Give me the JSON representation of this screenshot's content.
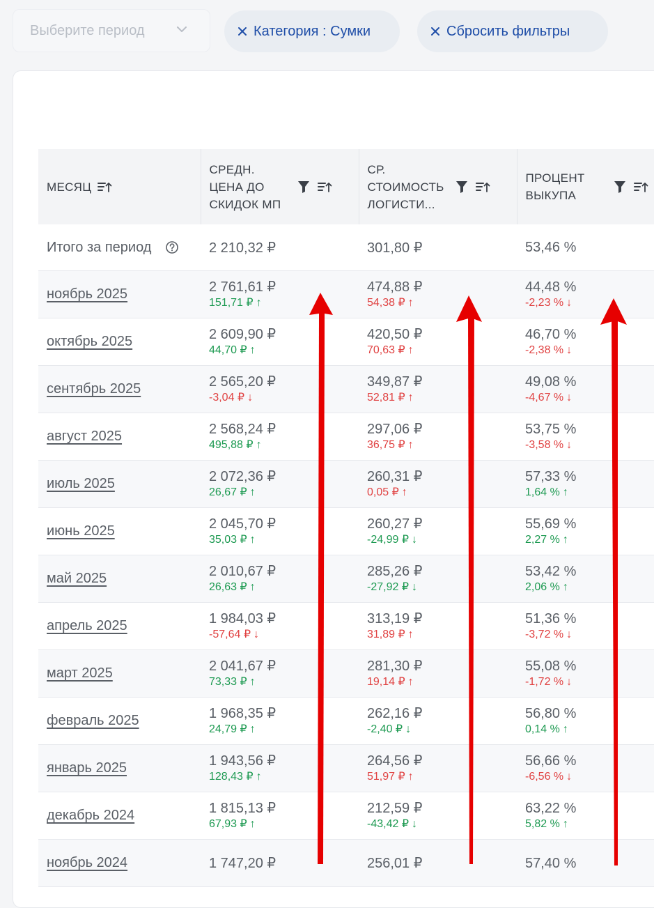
{
  "filters": {
    "period_placeholder": "Выберите период",
    "category_chip": "Категория : Сумки",
    "reset_chip": "Сбросить фильтры"
  },
  "table": {
    "headers": [
      {
        "label": "МЕСЯЦ"
      },
      {
        "label": "СРЕДН. ЦЕНА ДО СКИДОК МП"
      },
      {
        "label": "СР. СТОИМОСТЬ ЛОГИСТИ..."
      },
      {
        "label": "ПРОЦЕНТ ВЫКУПА"
      }
    ],
    "total": {
      "label": "Итого за период",
      "avg_price": "2 210,32 ₽",
      "logistics": "301,80 ₽",
      "buyout": "53,46 %"
    },
    "rows": [
      {
        "month": "ноябрь 2025",
        "avg_price": "2 761,61 ₽",
        "avg_price_delta": "151,71 ₽",
        "avg_price_dir": "up-green",
        "logistics": "474,88 ₽",
        "logistics_delta": "54,38 ₽",
        "logistics_dir": "up-red",
        "buyout": "44,48 %",
        "buyout_delta": "-2,23 %",
        "buyout_dir": "down-red"
      },
      {
        "month": "октябрь 2025",
        "avg_price": "2 609,90 ₽",
        "avg_price_delta": "44,70 ₽",
        "avg_price_dir": "up-green",
        "logistics": "420,50 ₽",
        "logistics_delta": "70,63 ₽",
        "logistics_dir": "up-red",
        "buyout": "46,70 %",
        "buyout_delta": "-2,38 %",
        "buyout_dir": "down-red"
      },
      {
        "month": "сентябрь 2025",
        "avg_price": "2 565,20 ₽",
        "avg_price_delta": "-3,04 ₽",
        "avg_price_dir": "down-red",
        "logistics": "349,87 ₽",
        "logistics_delta": "52,81 ₽",
        "logistics_dir": "up-red",
        "buyout": "49,08 %",
        "buyout_delta": "-4,67 %",
        "buyout_dir": "down-red"
      },
      {
        "month": "август 2025",
        "avg_price": "2 568,24 ₽",
        "avg_price_delta": "495,88 ₽",
        "avg_price_dir": "up-green",
        "logistics": "297,06 ₽",
        "logistics_delta": "36,75 ₽",
        "logistics_dir": "up-red",
        "buyout": "53,75 %",
        "buyout_delta": "-3,58 %",
        "buyout_dir": "down-red"
      },
      {
        "month": "июль 2025",
        "avg_price": "2 072,36 ₽",
        "avg_price_delta": "26,67 ₽",
        "avg_price_dir": "up-green",
        "logistics": "260,31 ₽",
        "logistics_delta": "0,05 ₽",
        "logistics_dir": "up-red",
        "buyout": "57,33 %",
        "buyout_delta": "1,64 %",
        "buyout_dir": "up-green"
      },
      {
        "month": "июнь 2025",
        "avg_price": "2 045,70 ₽",
        "avg_price_delta": "35,03 ₽",
        "avg_price_dir": "up-green",
        "logistics": "260,27 ₽",
        "logistics_delta": "-24,99 ₽",
        "logistics_dir": "down-green",
        "buyout": "55,69 %",
        "buyout_delta": "2,27 %",
        "buyout_dir": "up-green"
      },
      {
        "month": "май 2025",
        "avg_price": "2 010,67 ₽",
        "avg_price_delta": "26,63 ₽",
        "avg_price_dir": "up-green",
        "logistics": "285,26 ₽",
        "logistics_delta": "-27,92 ₽",
        "logistics_dir": "down-green",
        "buyout": "53,42 %",
        "buyout_delta": "2,06 %",
        "buyout_dir": "up-green"
      },
      {
        "month": "апрель 2025",
        "avg_price": "1 984,03 ₽",
        "avg_price_delta": "-57,64 ₽",
        "avg_price_dir": "down-red",
        "logistics": "313,19 ₽",
        "logistics_delta": "31,89 ₽",
        "logistics_dir": "up-red",
        "buyout": "51,36 %",
        "buyout_delta": "-3,72 %",
        "buyout_dir": "down-red"
      },
      {
        "month": "март 2025",
        "avg_price": "2 041,67 ₽",
        "avg_price_delta": "73,33 ₽",
        "avg_price_dir": "up-green",
        "logistics": "281,30 ₽",
        "logistics_delta": "19,14 ₽",
        "logistics_dir": "up-red",
        "buyout": "55,08 %",
        "buyout_delta": "-1,72 %",
        "buyout_dir": "down-red"
      },
      {
        "month": "февраль 2025",
        "avg_price": "1 968,35 ₽",
        "avg_price_delta": "24,79 ₽",
        "avg_price_dir": "up-green",
        "logistics": "262,16 ₽",
        "logistics_delta": "-2,40 ₽",
        "logistics_dir": "down-green",
        "buyout": "56,80 %",
        "buyout_delta": "0,14 %",
        "buyout_dir": "up-green"
      },
      {
        "month": "январь 2025",
        "avg_price": "1 943,56 ₽",
        "avg_price_delta": "128,43 ₽",
        "avg_price_dir": "up-green",
        "logistics": "264,56 ₽",
        "logistics_delta": "51,97 ₽",
        "logistics_dir": "up-red",
        "buyout": "56,66 %",
        "buyout_delta": "-6,56 %",
        "buyout_dir": "down-red"
      },
      {
        "month": "декабрь 2024",
        "avg_price": "1 815,13 ₽",
        "avg_price_delta": "67,93 ₽",
        "avg_price_dir": "up-green",
        "logistics": "212,59 ₽",
        "logistics_delta": "-43,42 ₽",
        "logistics_dir": "down-green",
        "buyout": "63,22 %",
        "buyout_delta": "5,82 %",
        "buyout_dir": "up-green"
      },
      {
        "month": "ноябрь 2024",
        "avg_price": "1 747,20 ₽",
        "avg_price_delta": "",
        "avg_price_dir": "",
        "logistics": "256,01 ₽",
        "logistics_delta": "",
        "logistics_dir": "",
        "buyout": "57,40 %",
        "buyout_delta": "",
        "buyout_dir": ""
      }
    ]
  },
  "colors": {
    "accent_link": "#1f4ea8",
    "positive": "#1e9a52",
    "negative": "#e04141",
    "annotation_arrow": "#e60000"
  },
  "icons": [
    "chevron-down-icon",
    "close-icon",
    "sort-icon",
    "filter-icon",
    "help-icon",
    "arrow-up-icon",
    "arrow-down-icon"
  ]
}
